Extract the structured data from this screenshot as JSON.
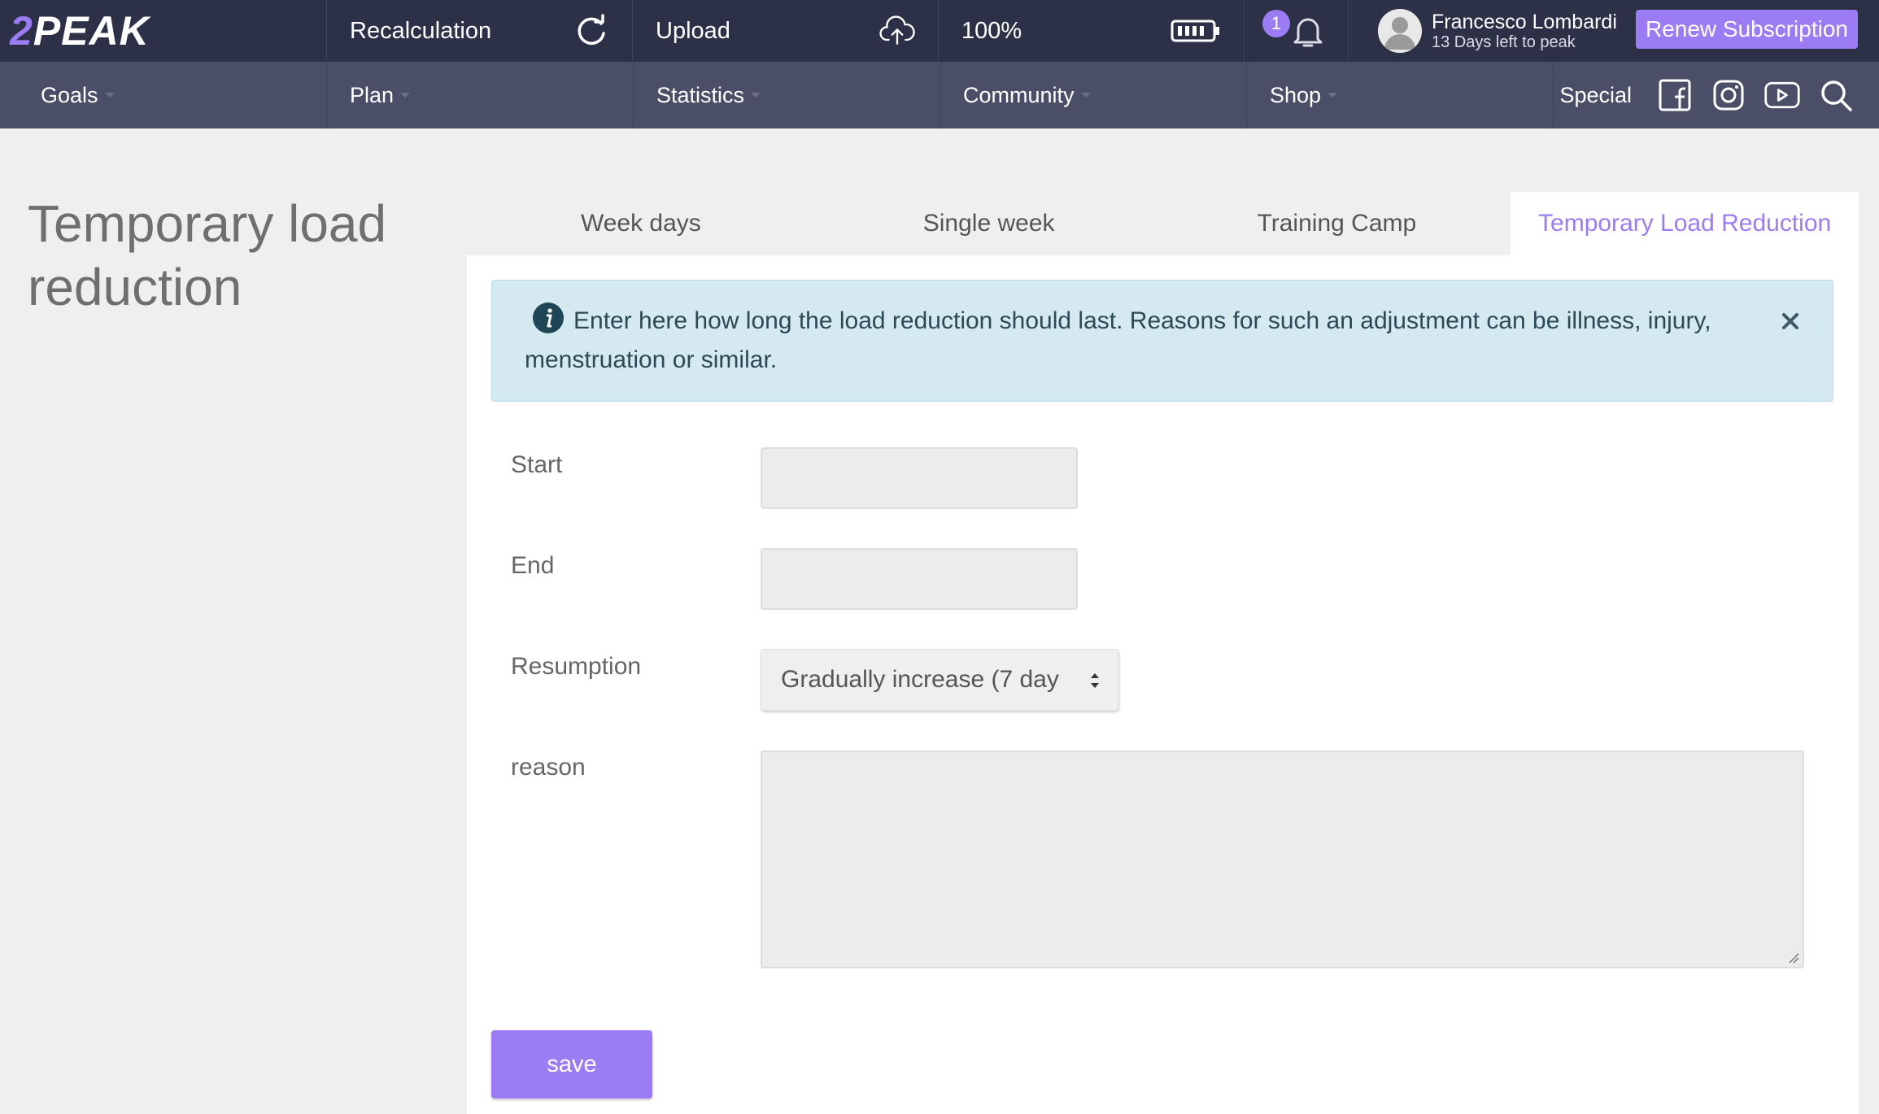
{
  "brand": {
    "logo_prefix": "2",
    "logo_text": "PEAK"
  },
  "topbar": {
    "recalculation_label": "Recalculation",
    "upload_label": "Upload",
    "battery_label": "100%",
    "notification_count": "1",
    "user_name": "Francesco Lombardi",
    "user_subtitle": "13 Days left to peak",
    "renew_label": "Renew Subscription"
  },
  "nav": {
    "items": [
      {
        "label": "Goals"
      },
      {
        "label": "Plan"
      },
      {
        "label": "Statistics"
      },
      {
        "label": "Community"
      },
      {
        "label": "Shop"
      }
    ],
    "special_label": "Special"
  },
  "page": {
    "title": "Temporary load reduction"
  },
  "tabs": [
    {
      "label": "Week days",
      "active": false
    },
    {
      "label": "Single week",
      "active": false
    },
    {
      "label": "Training Camp",
      "active": false
    },
    {
      "label": "Temporary Load Reduction",
      "active": true
    }
  ],
  "alert": {
    "text": "Enter here how long the load reduction should last. Reasons for such an adjustment can be illness, injury, menstruation or similar."
  },
  "form": {
    "start_label": "Start",
    "start_value": "",
    "end_label": "End",
    "end_value": "",
    "resumption_label": "Resumption",
    "resumption_value": "Gradually increase (7 day",
    "reason_label": "reason",
    "reason_value": "",
    "save_label": "save"
  },
  "colors": {
    "topbar_bg": "#2c3148",
    "navbar_bg": "#4a4f67",
    "accent": "#9b7cf4",
    "alert_bg": "#d5eaf0"
  }
}
